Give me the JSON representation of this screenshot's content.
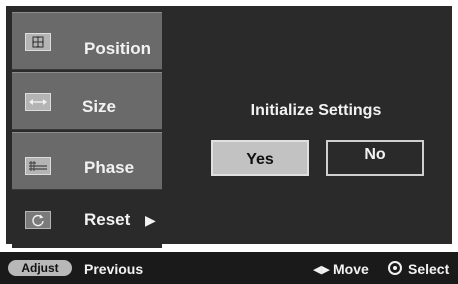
{
  "menu": {
    "items": [
      {
        "label": "Position",
        "icon": "position-icon"
      },
      {
        "label": "Size",
        "icon": "size-icon"
      },
      {
        "label": "Phase",
        "icon": "phase-icon"
      },
      {
        "label": "Reset",
        "icon": "reset-icon"
      }
    ]
  },
  "dialog": {
    "title": "Initialize Settings",
    "yes_label": "Yes",
    "no_label": "No"
  },
  "footer": {
    "adjust_label": "Adjust",
    "previous_label": "Previous",
    "move_label": "Move",
    "select_label": "Select"
  },
  "colors": {
    "panel_bg": "#2a2a2a",
    "menu_item_bg": "#6a6a6a",
    "selected_button_bg": "#c2c2c2"
  }
}
